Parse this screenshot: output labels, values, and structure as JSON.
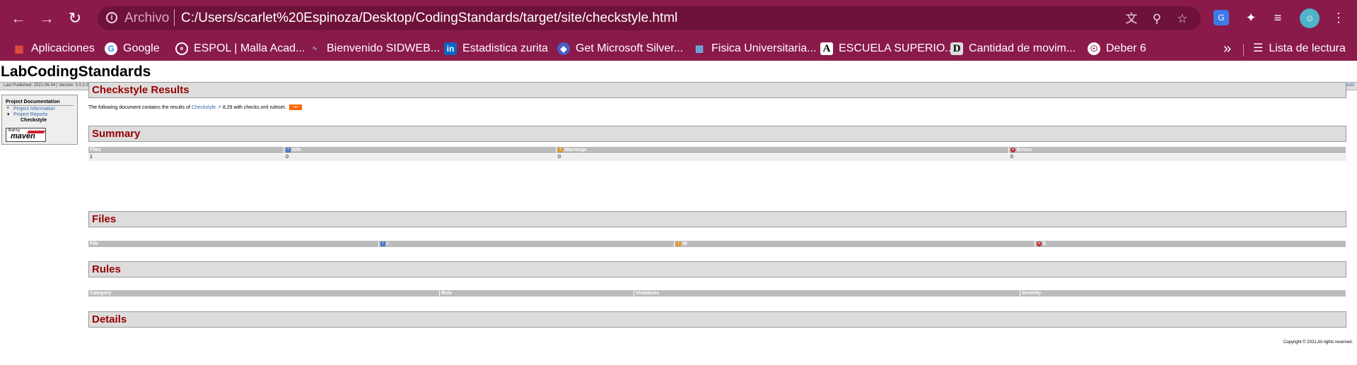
{
  "browser": {
    "address": {
      "scheme_label": "Archivo",
      "url": "C:/Users/scarlet%20Espinoza/Desktop/CodingStandards/target/site/checkstyle.html"
    },
    "bookmarks": [
      {
        "label": "Aplicaciones",
        "icon": "apps-grid-icon",
        "color": "#e94e3a"
      },
      {
        "label": "Google",
        "icon": "google-icon",
        "color": "#ffffff"
      },
      {
        "label": "ESPOL | Malla Acad...",
        "icon": "espol-icon",
        "color": "#ffffff"
      },
      {
        "label": "Bienvenido SIDWEB...",
        "icon": "sidweb-icon",
        "color": "#ffffff"
      },
      {
        "label": "Estadistica zurita",
        "icon": "linkedin-icon",
        "color": "#0a66c2"
      },
      {
        "label": "Get Microsoft Silver...",
        "icon": "silverlight-icon",
        "color": "#4a5fc1"
      },
      {
        "label": "Fisica Universitaria...",
        "icon": "fisica-icon",
        "color": "#6ab0e2"
      },
      {
        "label": "ESCUELA SUPERIO...",
        "icon": "letter-a-icon",
        "color": "#ffffff"
      },
      {
        "label": "Cantidad de movim...",
        "icon": "letter-d-icon",
        "color": "#ffffff"
      },
      {
        "label": "Deber 6",
        "icon": "globe-icon",
        "color": "#ffffff"
      }
    ],
    "more_label": "»",
    "reading_list_label": "Lista de lectura"
  },
  "site": {
    "title": "LabCodingStandards",
    "published": "Last Published: 2021-06-04  |  Version: 0.0.1-SNAPSHOT",
    "breadcrumb_right": "LabCodingStandards",
    "menu": {
      "heading": "Project Documentation",
      "items": [
        "Project Information",
        "Project Reports"
      ],
      "current": "Checkstyle",
      "badge_small": "Built by",
      "badge_big": "maven"
    },
    "footer": "Copyright © 2021.All rights reserved."
  },
  "report": {
    "title": "Checkstyle Results",
    "intro_prefix": "The following document contains the results of",
    "intro_link": "Checkstyle",
    "intro_suffix": "8.29 with  checks.xml ruleset.",
    "rss_label": "rss",
    "summary": {
      "heading": "Summary",
      "columns": [
        "Files",
        "Info",
        "Warnings",
        "Errors"
      ],
      "values": [
        "1",
        "0",
        "0",
        "0"
      ]
    },
    "files": {
      "heading": "Files",
      "columns": [
        "File",
        "I",
        "W",
        "E"
      ]
    },
    "rules": {
      "heading": "Rules",
      "columns": [
        "Category",
        "Rule",
        "Violations",
        "Severity"
      ]
    },
    "details": {
      "heading": "Details"
    }
  }
}
